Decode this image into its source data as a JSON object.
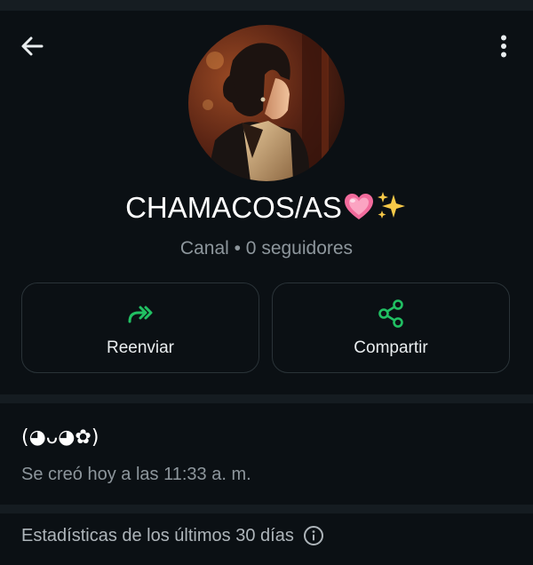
{
  "channel": {
    "name": "CHAMACOS/AS",
    "emojis": [
      "💗",
      "✨"
    ],
    "subtitle": "Canal • 0 seguidores"
  },
  "actions": [
    {
      "label": "Reenviar",
      "icon": "forward-icon"
    },
    {
      "label": "Compartir",
      "icon": "share-icon"
    }
  ],
  "description": {
    "text": "(◕ᴗ◕✿)",
    "created": "Se creó hoy a las 11:33 a. m."
  },
  "stats": {
    "label": "Estadísticas de los últimos 30 días"
  },
  "colors": {
    "background": "#0b1014",
    "accent": "#21c063",
    "muted_text": "#8d969c",
    "card_border": "#2a3338"
  },
  "icons": {
    "back": "back-arrow-icon",
    "menu": "more-vertical-icon",
    "info": "info-icon"
  }
}
